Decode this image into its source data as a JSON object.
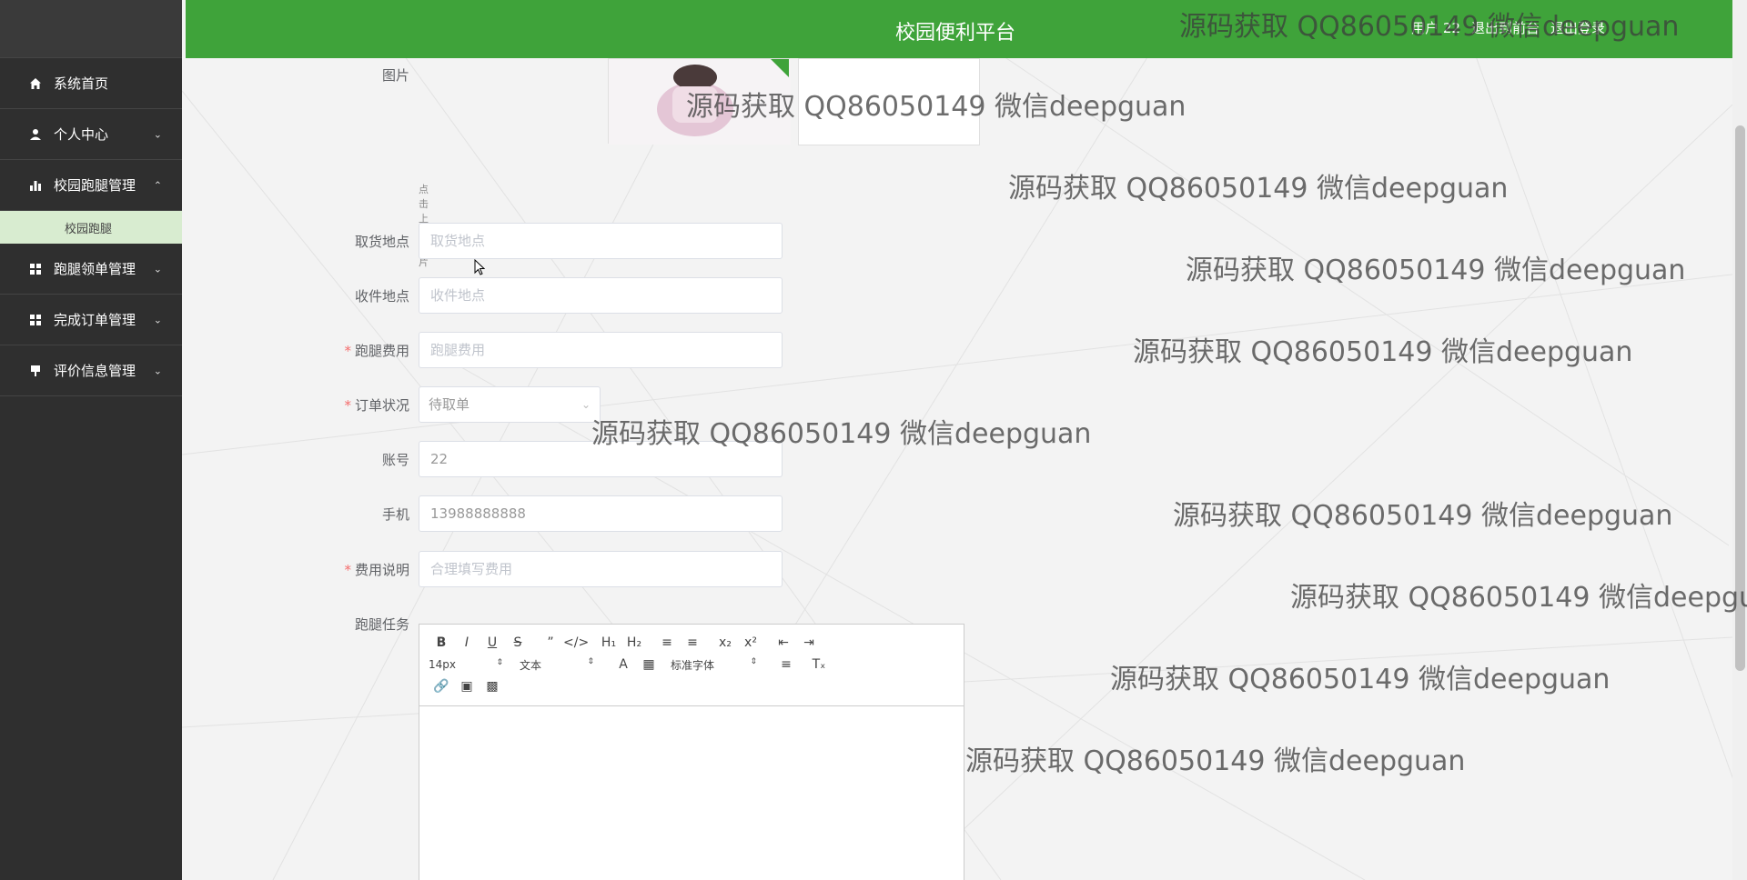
{
  "app": {
    "title": "校园便利平台"
  },
  "header": {
    "title": "校园便利平台",
    "user_text": "用户 22",
    "back_label": "退出到前台",
    "logout_label": "退出登录"
  },
  "sidebar": {
    "items": [
      {
        "label": "系统首页",
        "icon": "home-icon"
      },
      {
        "label": "个人中心",
        "icon": "user-icon",
        "expandable": true
      },
      {
        "label": "校园跑腿管理",
        "icon": "chart-icon",
        "expandable": true,
        "expanded": true
      },
      {
        "label": "跑腿领单管理",
        "icon": "grid-icon",
        "expandable": true
      },
      {
        "label": "完成订单管理",
        "icon": "grid-icon",
        "expandable": true
      },
      {
        "label": "评价信息管理",
        "icon": "pin-icon",
        "expandable": true
      }
    ],
    "submenu": {
      "label": "校园跑腿"
    }
  },
  "form": {
    "image": {
      "label": "图片",
      "upload_hint": "点击上传图片"
    },
    "pickup": {
      "label": "取货地点",
      "placeholder": "取货地点"
    },
    "delivery": {
      "label": "收件地点",
      "placeholder": "收件地点"
    },
    "fee": {
      "label": "跑腿费用",
      "placeholder": "跑腿费用",
      "required": true
    },
    "status": {
      "label": "订单状况",
      "value": "待取单",
      "required": true
    },
    "account": {
      "label": "账号",
      "value": "22"
    },
    "phone": {
      "label": "手机",
      "value": "13988888888"
    },
    "fee_note": {
      "label": "费用说明",
      "placeholder": "合理填写费用",
      "required": true
    },
    "task": {
      "label": "跑腿任务"
    }
  },
  "editor": {
    "font_size": "14px",
    "block_type": "文本",
    "font_family": "标准字体"
  },
  "watermark": "源码获取 QQ86050149 微信deepguan",
  "colors": {
    "header_bg": "#3fa33a",
    "sidebar_bg": "#2f2f2f",
    "submenu_bg": "#d8ecd0",
    "required": "#f56c6c"
  }
}
